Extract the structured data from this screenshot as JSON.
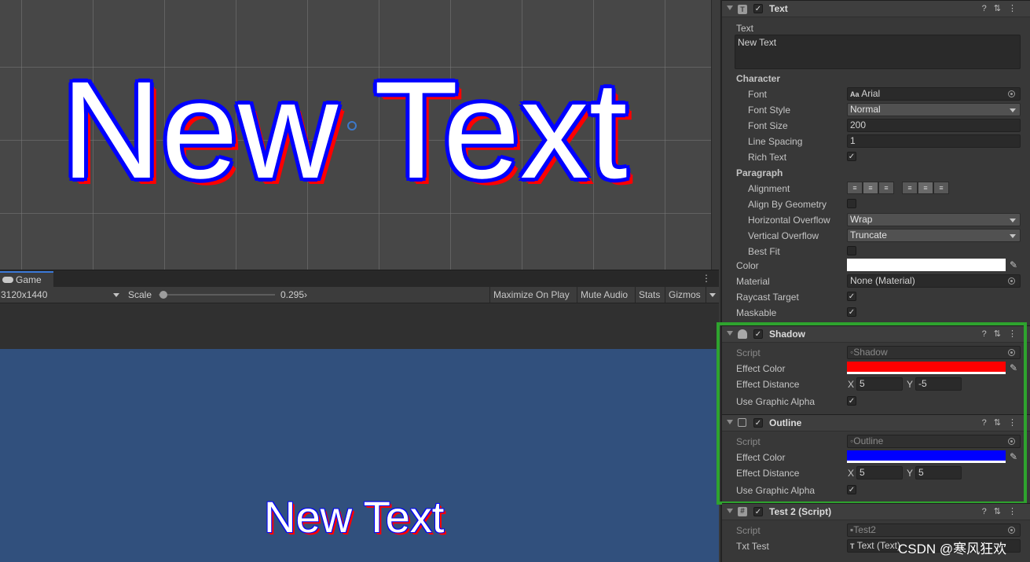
{
  "scene": {
    "canvas_text": "New Text"
  },
  "game": {
    "tab_label": "Game",
    "resolution": "3120x1440",
    "scale_label": "Scale",
    "scale_value": "0.295›",
    "scale_fraction": 0.04,
    "buttons": [
      "Maximize On Play",
      "Mute Audio",
      "Stats",
      "Gizmos"
    ],
    "canvas_text": "New Text"
  },
  "inspector": {
    "text_component": {
      "title": "Text",
      "text_label": "Text",
      "text_value": "New Text",
      "character_header": "Character",
      "font_label": "Font",
      "font_value": "Arial",
      "font_icon": "Aa",
      "font_style_label": "Font Style",
      "font_style_value": "Normal",
      "font_size_label": "Font Size",
      "font_size_value": "200",
      "line_spacing_label": "Line Spacing",
      "line_spacing_value": "1",
      "rich_text_label": "Rich Text",
      "paragraph_header": "Paragraph",
      "alignment_label": "Alignment",
      "align_by_geometry_label": "Align By Geometry",
      "horizontal_overflow_label": "Horizontal Overflow",
      "horizontal_overflow_value": "Wrap",
      "vertical_overflow_label": "Vertical Overflow",
      "vertical_overflow_value": "Truncate",
      "best_fit_label": "Best Fit",
      "color_label": "Color",
      "color_value": "#ffffff",
      "material_label": "Material",
      "material_value": "None (Material)",
      "raycast_label": "Raycast Target",
      "maskable_label": "Maskable"
    },
    "shadow_component": {
      "title": "Shadow",
      "script_label": "Script",
      "script_value": "Shadow",
      "effect_color_label": "Effect Color",
      "effect_color": "#ff0000",
      "effect_distance_label": "Effect Distance",
      "x_label": "X",
      "x_value": "5",
      "y_label": "Y",
      "y_value": "-5",
      "use_graphic_alpha_label": "Use Graphic Alpha"
    },
    "outline_component": {
      "title": "Outline",
      "script_label": "Script",
      "script_value": "Outline",
      "effect_color_label": "Effect Color",
      "effect_color": "#0000ff",
      "effect_distance_label": "Effect Distance",
      "x_label": "X",
      "x_value": "5",
      "y_label": "Y",
      "y_value": "5",
      "use_graphic_alpha_label": "Use Graphic Alpha"
    },
    "test2_component": {
      "title": "Test 2 (Script)",
      "script_label": "Script",
      "script_value": "Test2",
      "txt_test_label": "Txt Test",
      "txt_test_value": "Text (Text)"
    }
  },
  "watermark": "CSDN @寒风狂欢",
  "colors": {
    "highlight_box": "#2ea32e",
    "game_background": "#31507d",
    "tab_accent": "#3a79d8"
  }
}
